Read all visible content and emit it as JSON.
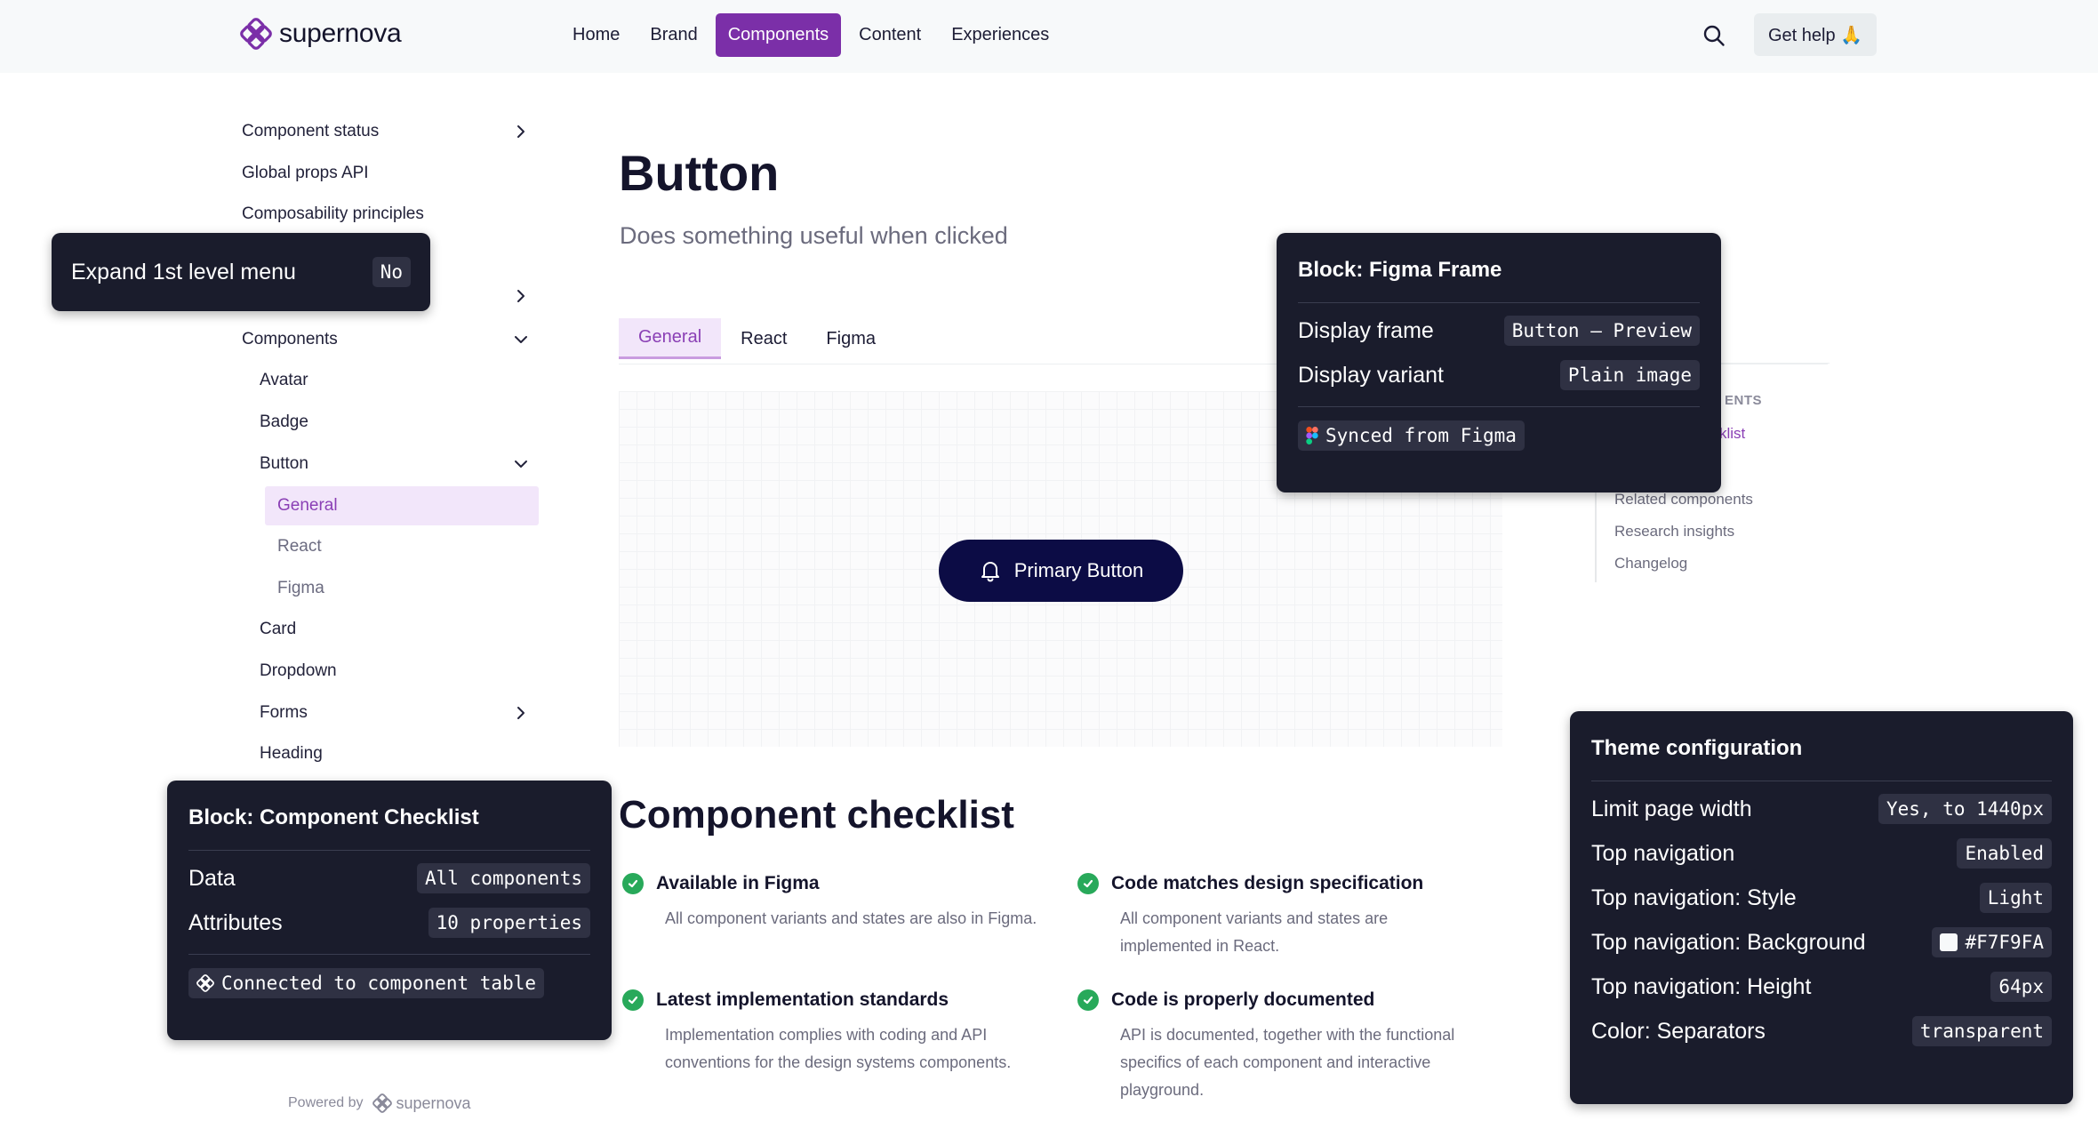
{
  "brand": {
    "name": "supernova",
    "accent": "#7B2FA8",
    "nav_bg": "#F7F9FA",
    "dark_navy": "#0C0C45",
    "overlay_bg": "#1A1C2C",
    "success": "#28A95A"
  },
  "nav": {
    "items": [
      {
        "label": "Home",
        "active": false
      },
      {
        "label": "Brand",
        "active": false
      },
      {
        "label": "Components",
        "active": true
      },
      {
        "label": "Content",
        "active": false
      },
      {
        "label": "Experiences",
        "active": false
      }
    ],
    "search_icon": "search-icon",
    "help_label": "Get help 🙏"
  },
  "sidebar": {
    "items": [
      {
        "label": "Component status"
      },
      {
        "label": "Global props API"
      },
      {
        "label": "Composability principles"
      },
      {
        "label": "Components"
      },
      {
        "label": "Avatar"
      },
      {
        "label": "Badge"
      },
      {
        "label": "Button"
      },
      {
        "label": "General",
        "active": true
      },
      {
        "label": "React"
      },
      {
        "label": "Figma"
      },
      {
        "label": "Card"
      },
      {
        "label": "Dropdown"
      },
      {
        "label": "Forms"
      },
      {
        "label": "Heading"
      }
    ],
    "powered_by": "Powered by",
    "powered_brand": "supernova"
  },
  "main": {
    "title": "Button",
    "subtitle": "Does something useful when clicked",
    "tabs": [
      {
        "label": "General",
        "active": true
      },
      {
        "label": "React",
        "active": false
      },
      {
        "label": "Figma",
        "active": false
      }
    ],
    "preview_button": "Primary Button",
    "checklist": {
      "title": "Component checklist",
      "items": [
        {
          "title": "Available in Figma",
          "desc": "All component variants and states are also in Figma."
        },
        {
          "title": "Code matches design specification",
          "desc": "All component variants and states are implemented in React."
        },
        {
          "title": "Latest implementation standards",
          "desc": "Implementation complies with coding and API conventions for the design systems components."
        },
        {
          "title": "Code is properly documented",
          "desc": "API is documented, together with the functional specifics of each component and interactive playground."
        }
      ]
    }
  },
  "toc": {
    "heading_partial": "ENTS",
    "active_partial": "ecklist",
    "links": [
      "Related components",
      "Research insights",
      "Changelog"
    ]
  },
  "overlays": {
    "expand_menu": {
      "label": "Expand 1st level menu",
      "value": "No"
    },
    "figma_frame": {
      "title": "Block: Figma Frame",
      "rows": [
        {
          "label": "Display frame",
          "value": "Button – Preview"
        },
        {
          "label": "Display variant",
          "value": "Plain image"
        }
      ],
      "badge": "Synced from Figma"
    },
    "checklist_block": {
      "title": "Block: Component Checklist",
      "rows": [
        {
          "label": "Data",
          "value": "All components"
        },
        {
          "label": "Attributes",
          "value": "10 properties"
        }
      ],
      "badge": "Connected to component table"
    },
    "theme": {
      "title": "Theme configuration",
      "rows": [
        {
          "label": "Limit page width",
          "value": "Yes, to 1440px"
        },
        {
          "label": "Top navigation",
          "value": "Enabled"
        },
        {
          "label": "Top navigation: Style",
          "value": "Light"
        },
        {
          "label": "Top navigation: Background",
          "value": "#F7F9FA",
          "swatch": "#F7F9FA"
        },
        {
          "label": "Top navigation: Height",
          "value": "64px"
        },
        {
          "label": "Color: Separators",
          "value": "transparent"
        }
      ]
    }
  }
}
